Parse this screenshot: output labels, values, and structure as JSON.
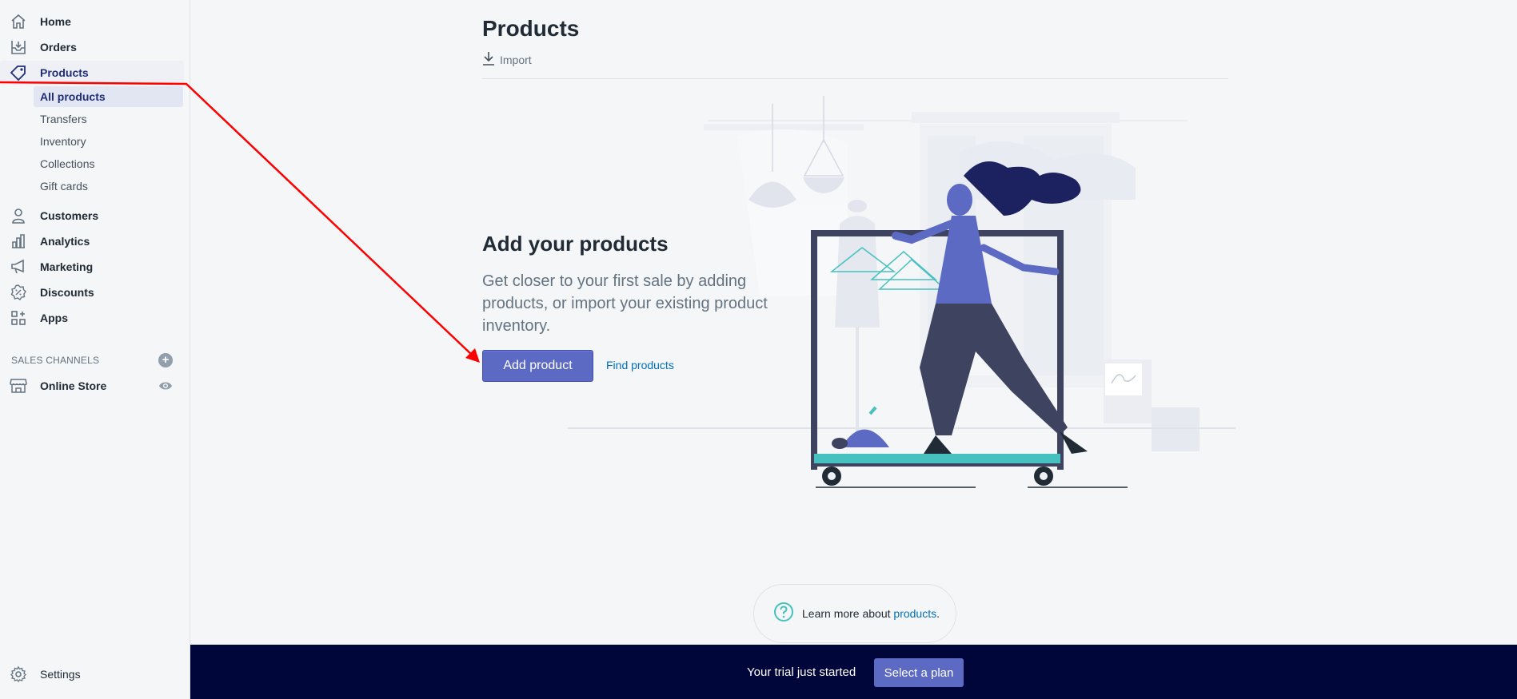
{
  "sidebar": {
    "nav": [
      {
        "label": "Home",
        "icon": "home-icon"
      },
      {
        "label": "Orders",
        "icon": "orders-icon"
      },
      {
        "label": "Products",
        "icon": "tag-icon"
      },
      {
        "label": "Customers",
        "icon": "customer-icon"
      },
      {
        "label": "Analytics",
        "icon": "analytics-icon"
      },
      {
        "label": "Marketing",
        "icon": "megaphone-icon"
      },
      {
        "label": "Discounts",
        "icon": "discount-icon"
      },
      {
        "label": "Apps",
        "icon": "apps-icon"
      }
    ],
    "products_sub": [
      {
        "label": "All products"
      },
      {
        "label": "Transfers"
      },
      {
        "label": "Inventory"
      },
      {
        "label": "Collections"
      },
      {
        "label": "Gift cards"
      }
    ],
    "sales_channels_title": "SALES CHANNELS",
    "channels": [
      {
        "label": "Online Store",
        "icon": "store-icon"
      }
    ],
    "settings": {
      "label": "Settings",
      "icon": "gear-icon"
    }
  },
  "main": {
    "title": "Products",
    "import_label": "Import",
    "empty_state": {
      "title": "Add your products",
      "description": "Get closer to your first sale by adding products, or import your existing product inventory.",
      "primary_action": "Add product",
      "secondary_action": "Find products"
    },
    "help": {
      "prefix": "Learn more about ",
      "link": "products",
      "suffix": "."
    }
  },
  "trial_bar": {
    "text": "Your trial just started",
    "button": "Select a plan"
  },
  "colors": {
    "primary": "#5c6ac4",
    "active_nav": "#202e78",
    "link": "#006fbb",
    "trial_bar": "#000639",
    "annotation": "#ff0000"
  }
}
